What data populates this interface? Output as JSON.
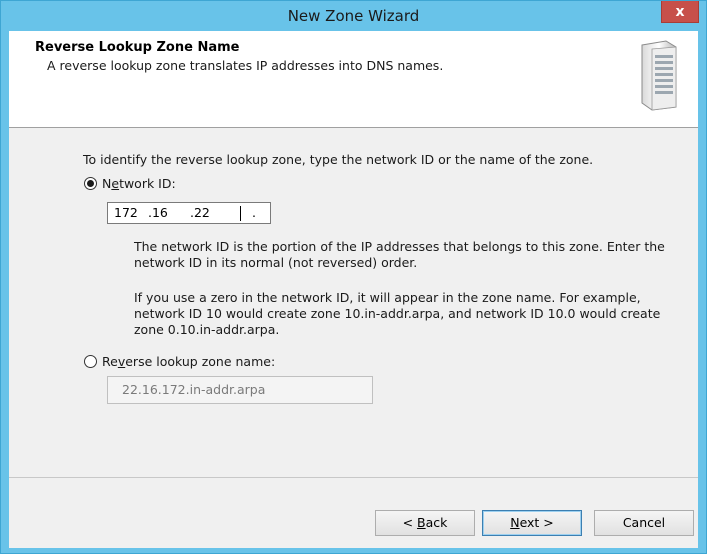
{
  "window": {
    "title": "New Zone Wizard",
    "close_glyph": "x"
  },
  "header": {
    "title": "Reverse Lookup Zone Name",
    "subtitle": "A reverse lookup zone translates IP addresses into DNS names.",
    "icon": "server-icon"
  },
  "main": {
    "intro": "To identify the reverse lookup zone, type the network ID or the name of the zone.",
    "network_id_option": {
      "prefix": "N",
      "accel": "e",
      "suffix": "twork ID:",
      "checked": true
    },
    "network_id_segments": [
      "172",
      ".16",
      ".22",
      "."
    ],
    "help_paragraph_1_line_1": "The network ID is the portion of the IP addresses that belongs to this zone. Enter the",
    "help_paragraph_1_line_2": "network ID in its normal (not reversed) order.",
    "help_paragraph_2_line_1": "If you use a zero in the network ID, it will appear in the zone name. For example,",
    "help_paragraph_2_line_2": "network ID 10 would create zone 10.in-addr.arpa, and network ID 10.0 would create",
    "help_paragraph_2_line_3": "zone 0.10.in-addr.arpa.",
    "reverse_option": {
      "prefix": "Re",
      "accel": "v",
      "suffix": "erse lookup zone name:",
      "checked": false
    },
    "reverse_zone_value": "22.16.172.in-addr.arpa"
  },
  "footer": {
    "back": {
      "prefix": "< ",
      "accel": "B",
      "suffix": "ack"
    },
    "next": {
      "prefix": "",
      "accel": "N",
      "suffix": "ext >"
    },
    "cancel": "Cancel"
  }
}
